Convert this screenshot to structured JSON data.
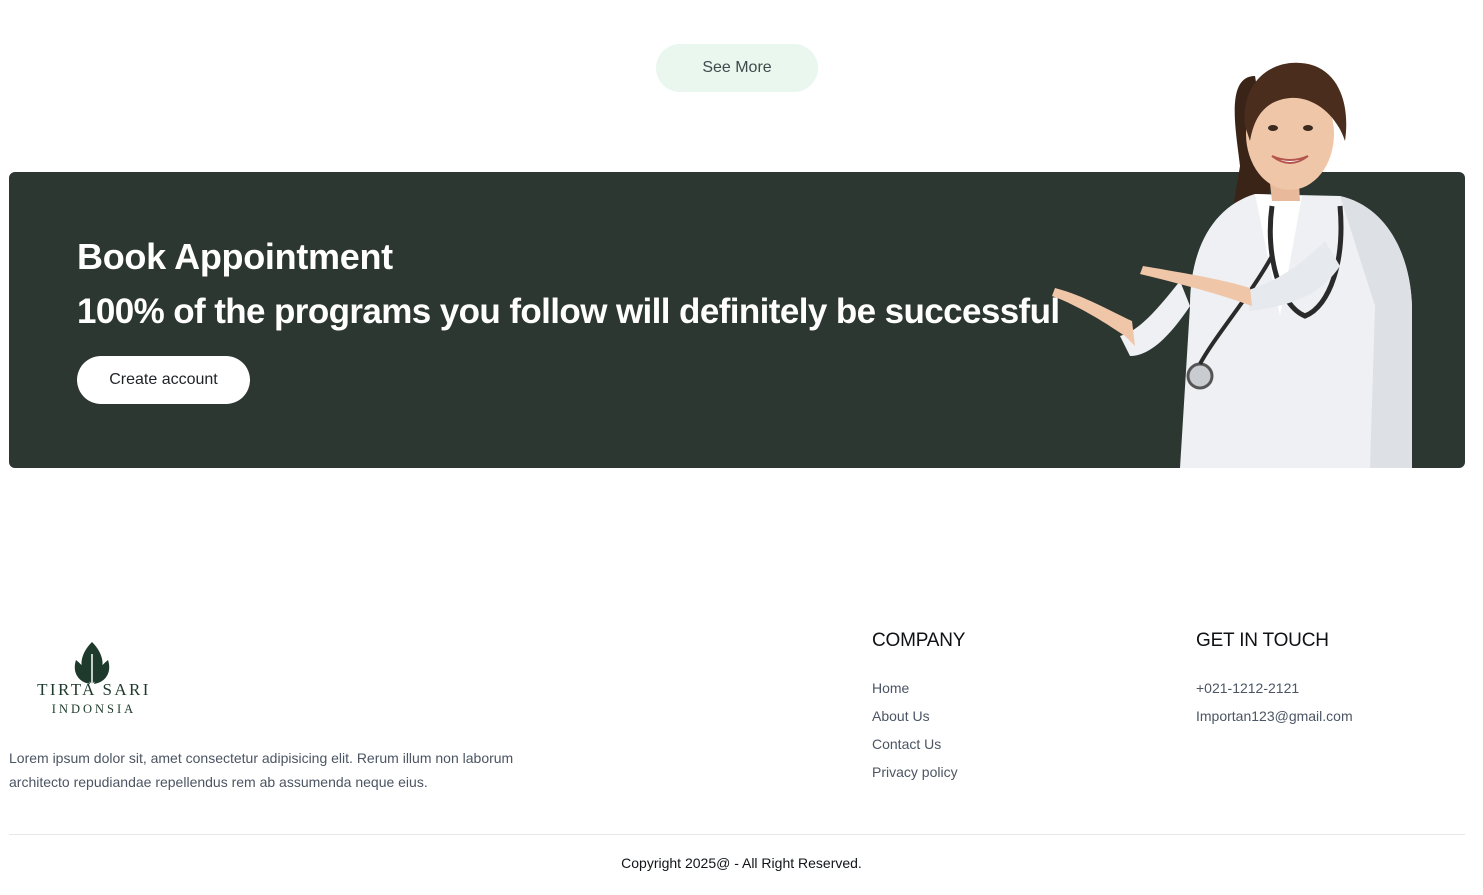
{
  "see_more": {
    "label": "See More"
  },
  "banner": {
    "title": "Book Appointment",
    "subtitle": "100% of the programs you follow will definitely be successful",
    "cta_label": "Create account",
    "bg_color": "#2d3731"
  },
  "footer": {
    "brand": {
      "name_line1": "TIRTA SARI",
      "name_line2": "INDONSIA",
      "icon": "leaf-logo-icon"
    },
    "description": "Lorem ipsum dolor sit, amet consectetur adipisicing elit. Rerum illum non laborum architecto repudiandae repellendus rem ab assumenda neque eius.",
    "company": {
      "heading": "COMPANY",
      "links": [
        "Home",
        "About Us",
        "Contact Us",
        "Privacy policy"
      ]
    },
    "contact": {
      "heading": "GET IN TOUCH",
      "items": [
        "+021-1212-2121",
        "Importan123@gmail.com"
      ]
    },
    "copyright": "Copyright 2025@ - All Right Reserved."
  },
  "colors": {
    "accent_light": "#e9f7ef",
    "brand_dark": "#1d3a2c"
  }
}
